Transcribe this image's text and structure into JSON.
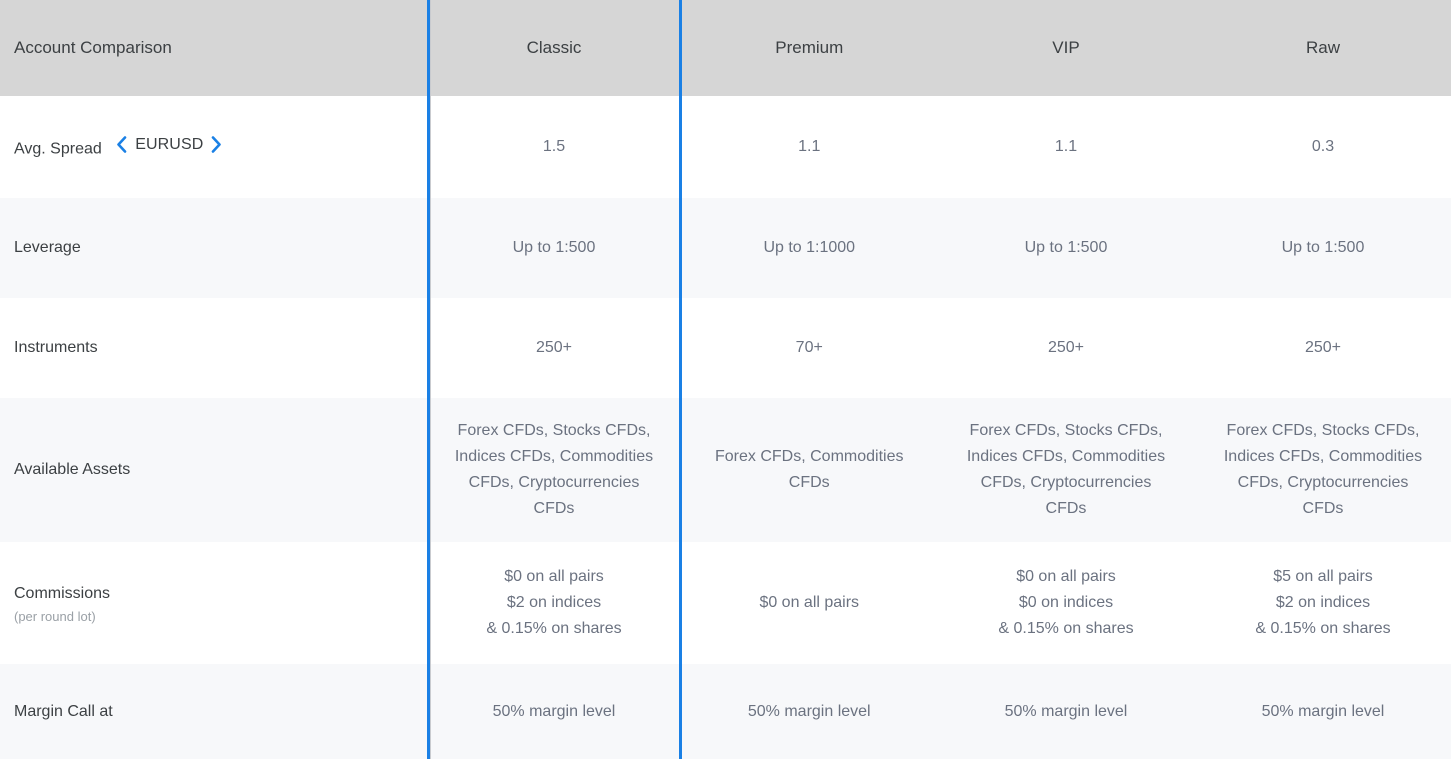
{
  "table": {
    "header": {
      "label": "Account Comparison",
      "plans": [
        "Classic",
        "Premium",
        "VIP",
        "Raw"
      ]
    },
    "accent_color": "#1a80e5",
    "header_bg": "#d6d6d6",
    "row_alt_bg": "#f7f8fa",
    "rows": [
      {
        "label": "Avg. Spread",
        "pair_picker": {
          "prev_icon": "chevron-left-icon",
          "pair": "EURUSD",
          "next_icon": "chevron-right-icon"
        },
        "values": [
          "1.5",
          "1.1",
          "1.1",
          "0.3"
        ]
      },
      {
        "label": "Leverage",
        "values": [
          "Up to 1:500",
          "Up to 1:1000",
          "Up to 1:500",
          "Up to 1:500"
        ]
      },
      {
        "label": "Instruments",
        "values": [
          "250+",
          "70+",
          "250+",
          "250+"
        ]
      },
      {
        "label": "Available Assets",
        "values": [
          "Forex CFDs, Stocks CFDs,\nIndices CFDs, Commodities\nCFDs, Cryptocurrencies\nCFDs",
          "Forex CFDs, Commodities\nCFDs",
          "Forex CFDs, Stocks CFDs,\nIndices CFDs, Commodities\nCFDs, Cryptocurrencies\nCFDs",
          "Forex CFDs, Stocks CFDs,\nIndices CFDs, Commodities\nCFDs, Cryptocurrencies\nCFDs"
        ]
      },
      {
        "label": "Commissions",
        "sublabel": "(per round lot)",
        "values": [
          "$0 on all pairs\n$2 on indices\n& 0.15% on shares",
          "$0 on all pairs",
          "$0 on all pairs\n$0 on indices\n& 0.15% on shares",
          "$5 on all pairs\n$2 on indices\n& 0.15% on shares"
        ]
      },
      {
        "label": "Margin Call at",
        "values": [
          "50% margin level",
          "50% margin level",
          "50% margin level",
          "50% margin level"
        ]
      }
    ]
  }
}
